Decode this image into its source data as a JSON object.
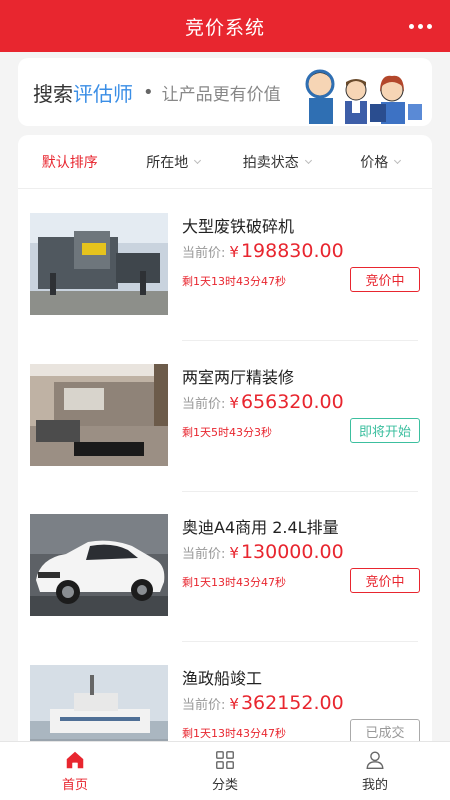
{
  "header": {
    "title": "竞价系统",
    "more_icon": "more-dots-icon"
  },
  "banner": {
    "search_prefix": "搜索",
    "search_highlight": "评估师",
    "dot": "•",
    "slogan": "让产品更有价值"
  },
  "filters": [
    {
      "label": "默认排序",
      "active": true
    },
    {
      "label": "所在地"
    },
    {
      "label": "拍卖状态"
    },
    {
      "label": "价格"
    }
  ],
  "items": [
    {
      "name": "大型废铁破碎机",
      "price_label": "当前价:",
      "currency": "¥",
      "price": "198830.00",
      "remain": "剩1天13时43分47秒",
      "status": "竞价中",
      "status_color": "#e8262f"
    },
    {
      "name": "两室两厅精装修",
      "price_label": "当前价:",
      "currency": "¥",
      "price": "656320.00",
      "remain": "剩1天5时43分3秒",
      "status": "即将开始",
      "status_color": "#3cbf9f"
    },
    {
      "name": "奥迪A4商用  2.4L排量",
      "price_label": "当前价:",
      "currency": "¥",
      "price": "130000.00",
      "remain": "剩1天13时43分47秒",
      "status": "竞价中",
      "status_color": "#e8262f"
    },
    {
      "name": "渔政船竣工",
      "price_label": "当前价:",
      "currency": "¥",
      "price": "362152.00",
      "remain": "剩1天13时43分47秒",
      "status": "已成交",
      "status_color": "#999999"
    }
  ],
  "tabbar": [
    {
      "label": "首页",
      "icon": "home-icon",
      "active": true
    },
    {
      "label": "分类",
      "icon": "grid-icon"
    },
    {
      "label": "我的",
      "icon": "user-icon"
    }
  ],
  "colors": {
    "brand": "#e8262f",
    "accent_blue": "#3a8ee6"
  }
}
